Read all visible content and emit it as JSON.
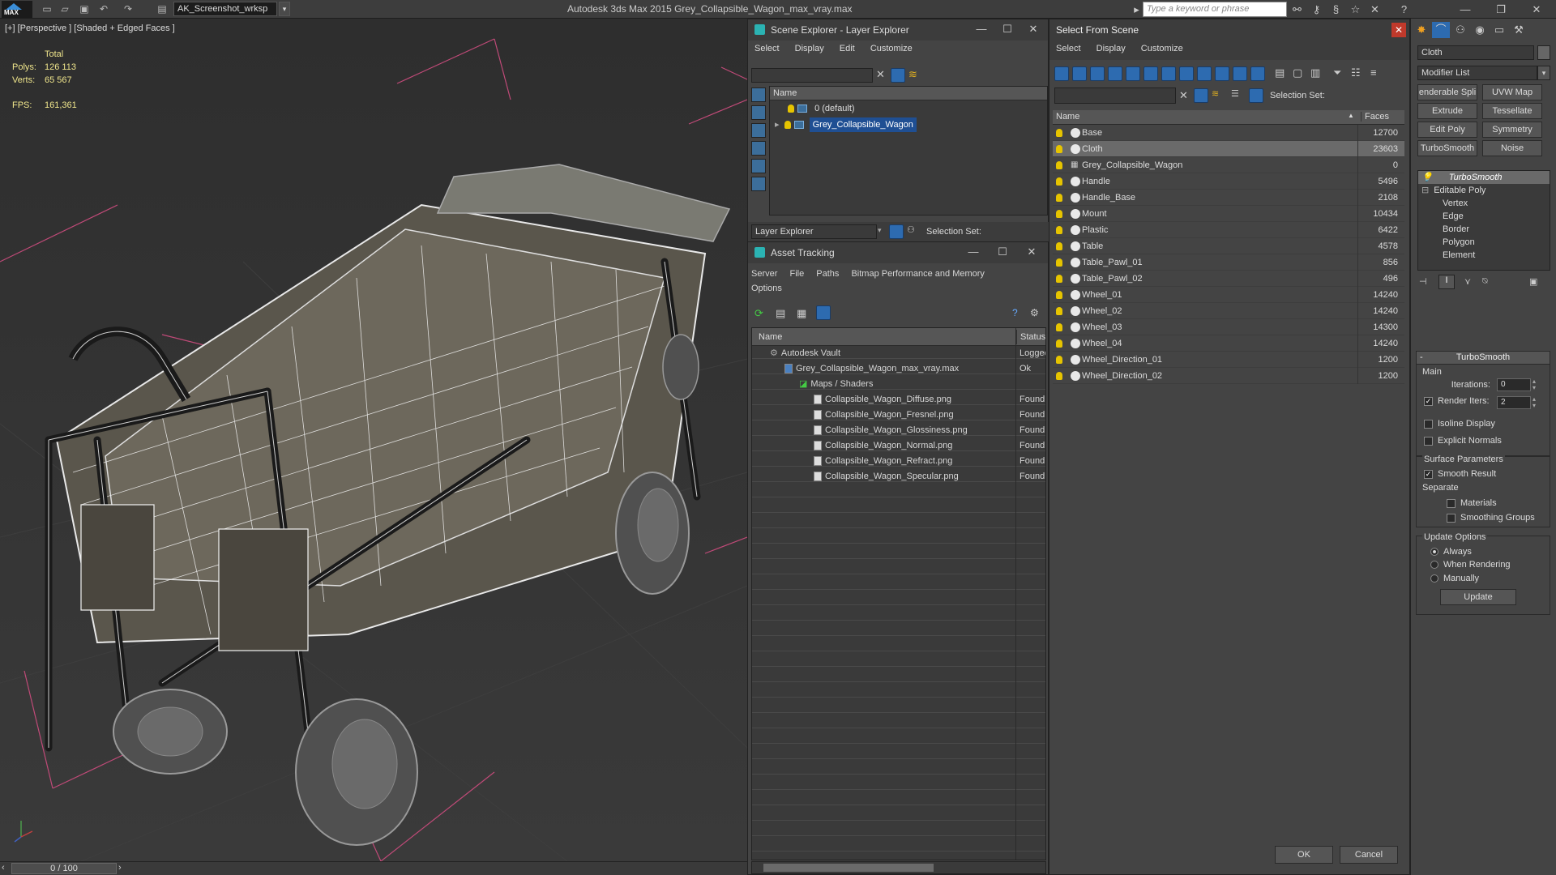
{
  "titlebar": {
    "logo": "MAX",
    "workspace": "AK_Screenshot_wrksp",
    "app_title": "Autodesk 3ds Max  2015      Grey_Collapsible_Wagon_max_vray.max",
    "search_placeholder": "Type a keyword or phrase"
  },
  "viewport": {
    "label": "[+] [Perspective ] [Shaded + Edged Faces ]",
    "stats_header": "Total",
    "polys_label": "Polys:",
    "polys_value": "126 113",
    "verts_label": "Verts:",
    "verts_value": "65 567",
    "fps_label": "FPS:",
    "fps_value": "161,361",
    "timeline": "0 / 100"
  },
  "scene_explorer": {
    "title": "Scene Explorer - Layer Explorer",
    "menu": [
      "Select",
      "Display",
      "Edit",
      "Customize"
    ],
    "column_name": "Name",
    "layers": [
      "0 (default)",
      "Grey_Collapsible_Wagon"
    ],
    "bottom_label": "Layer Explorer",
    "selection_set_label": "Selection Set:"
  },
  "asset_tracking": {
    "title": "Asset Tracking",
    "menu": [
      "Server",
      "File",
      "Paths",
      "Bitmap Performance and Memory",
      "Options"
    ],
    "col_name": "Name",
    "col_status": "Status",
    "rows": [
      {
        "name": "Autodesk Vault",
        "status": "Logged"
      },
      {
        "name": "Grey_Collapsible_Wagon_max_vray.max",
        "status": "Ok"
      },
      {
        "name": "Maps / Shaders",
        "status": ""
      },
      {
        "name": "Collapsible_Wagon_Diffuse.png",
        "status": "Found"
      },
      {
        "name": "Collapsible_Wagon_Fresnel.png",
        "status": "Found"
      },
      {
        "name": "Collapsible_Wagon_Glossiness.png",
        "status": "Found"
      },
      {
        "name": "Collapsible_Wagon_Normal.png",
        "status": "Found"
      },
      {
        "name": "Collapsible_Wagon_Refract.png",
        "status": "Found"
      },
      {
        "name": "Collapsible_Wagon_Specular.png",
        "status": "Found"
      }
    ]
  },
  "select_from_scene": {
    "title": "Select From Scene",
    "menu": [
      "Select",
      "Display",
      "Customize"
    ],
    "selection_set_label": "Selection Set:",
    "col_name": "Name",
    "col_faces": "Faces",
    "rows": [
      {
        "name": "Base",
        "faces": "12700"
      },
      {
        "name": "Cloth",
        "faces": "23603"
      },
      {
        "name": "Grey_Collapsible_Wagon",
        "faces": "0"
      },
      {
        "name": "Handle",
        "faces": "5496"
      },
      {
        "name": "Handle_Base",
        "faces": "2108"
      },
      {
        "name": "Mount",
        "faces": "10434"
      },
      {
        "name": "Plastic",
        "faces": "6422"
      },
      {
        "name": "Table",
        "faces": "4578"
      },
      {
        "name": "Table_Pawl_01",
        "faces": "856"
      },
      {
        "name": "Table_Pawl_02",
        "faces": "496"
      },
      {
        "name": "Wheel_01",
        "faces": "14240"
      },
      {
        "name": "Wheel_02",
        "faces": "14240"
      },
      {
        "name": "Wheel_03",
        "faces": "14300"
      },
      {
        "name": "Wheel_04",
        "faces": "14240"
      },
      {
        "name": "Wheel_Direction_01",
        "faces": "1200"
      },
      {
        "name": "Wheel_Direction_02",
        "faces": "1200"
      }
    ],
    "ok": "OK",
    "cancel": "Cancel"
  },
  "command_panel": {
    "object_name": "Cloth",
    "modifier_list": "Modifier List",
    "buttons": [
      "enderable Spli",
      "UVW Map",
      "Extrude",
      "Tessellate",
      "Edit Poly",
      "Symmetry",
      "TurboSmooth",
      "Noise"
    ],
    "stack": [
      "TurboSmooth",
      "Editable Poly",
      "Vertex",
      "Edge",
      "Border",
      "Polygon",
      "Element"
    ],
    "rollout": "TurboSmooth",
    "main_label": "Main",
    "iterations_label": "Iterations:",
    "iterations_value": "0",
    "render_iters_label": "Render Iters:",
    "render_iters_value": "2",
    "isoline": "Isoline Display",
    "explicit_normals": "Explicit Normals",
    "surface_params": "Surface Parameters",
    "smooth_result": "Smooth Result",
    "separate": "Separate",
    "materials": "Materials",
    "smoothing_groups": "Smoothing Groups",
    "update_options": "Update Options",
    "always": "Always",
    "when_rendering": "When Rendering",
    "manually": "Manually",
    "update_btn": "Update"
  }
}
